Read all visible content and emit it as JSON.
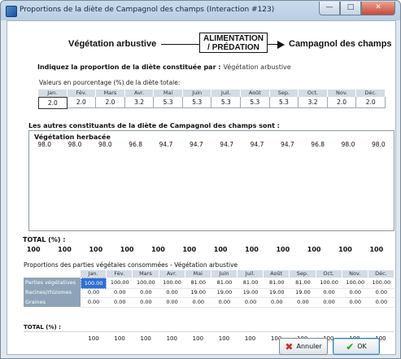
{
  "window": {
    "title": "Proportions de la diète de Campagnol des champs (Interaction #123)",
    "buttons": {
      "minimize": "—",
      "maximize": "□",
      "close": "✕"
    }
  },
  "flow": {
    "left": "Végétation arbustive",
    "box_line1": "ALIMENTATION",
    "box_line2": "/ PRÉDATION",
    "right": "Campagnol des champs"
  },
  "prompt": {
    "label": "Indiquez la proportion de la diète constituée par :",
    "value": "Végétation arbustive"
  },
  "percent_label": "Valeurs en pourcentage (%) de la diète totale:",
  "months": [
    "Jan.",
    "Fév.",
    "Mars",
    "Avr.",
    "Mai",
    "Juin",
    "Juil.",
    "Août",
    "Sep.",
    "Oct.",
    "Nov.",
    "Déc."
  ],
  "diet_values": [
    "2.0",
    "2.0",
    "2.0",
    "3.2",
    "5.3",
    "5.3",
    "5.3",
    "5.3",
    "5.3",
    "3.2",
    "2.0",
    "2.0"
  ],
  "others": {
    "title": "Les autres constituants de la diète de  Campagnol des champs  sont :",
    "items": [
      {
        "name": "Végétation herbacée",
        "values": [
          "98.0",
          "98.0",
          "98.0",
          "96.8",
          "94.7",
          "94.7",
          "94.7",
          "94.7",
          "94.7",
          "96.8",
          "98.0",
          "98.0"
        ]
      }
    ]
  },
  "total": {
    "label": "TOTAL (%) :",
    "values": [
      "100",
      "100",
      "100",
      "100",
      "100",
      "100",
      "100",
      "100",
      "100",
      "100",
      "100",
      "100"
    ]
  },
  "parts": {
    "title": "Proportions des parties végétales consommées - Végétation arbustive",
    "rows": [
      {
        "label": "Parties végétatives",
        "values": [
          "100.00",
          "100.00",
          "100.00",
          "100.00",
          "81.00",
          "81.00",
          "81.00",
          "81.00",
          "81.00",
          "100.00",
          "100.00",
          "100.00"
        ]
      },
      {
        "label": "Racines/rhizomes",
        "values": [
          "0.00",
          "0.00",
          "0.00",
          "0.00",
          "19.00",
          "19.00",
          "19.00",
          "19.00",
          "19.00",
          "0.00",
          "0.00",
          "0.00"
        ]
      },
      {
        "label": "Graines",
        "values": [
          "0.00",
          "0.00",
          "0.00",
          "0.00",
          "0.00",
          "0.00",
          "0.00",
          "0.00",
          "0.00",
          "0.00",
          "0.00",
          "0.00"
        ]
      }
    ],
    "total_label": "TOTAL (%) :",
    "total_values": [
      "100",
      "100",
      "100",
      "100",
      "100",
      "100",
      "100",
      "100",
      "100",
      "100",
      "100",
      "100"
    ]
  },
  "buttons": {
    "cancel": "Annuler",
    "ok": "OK"
  }
}
